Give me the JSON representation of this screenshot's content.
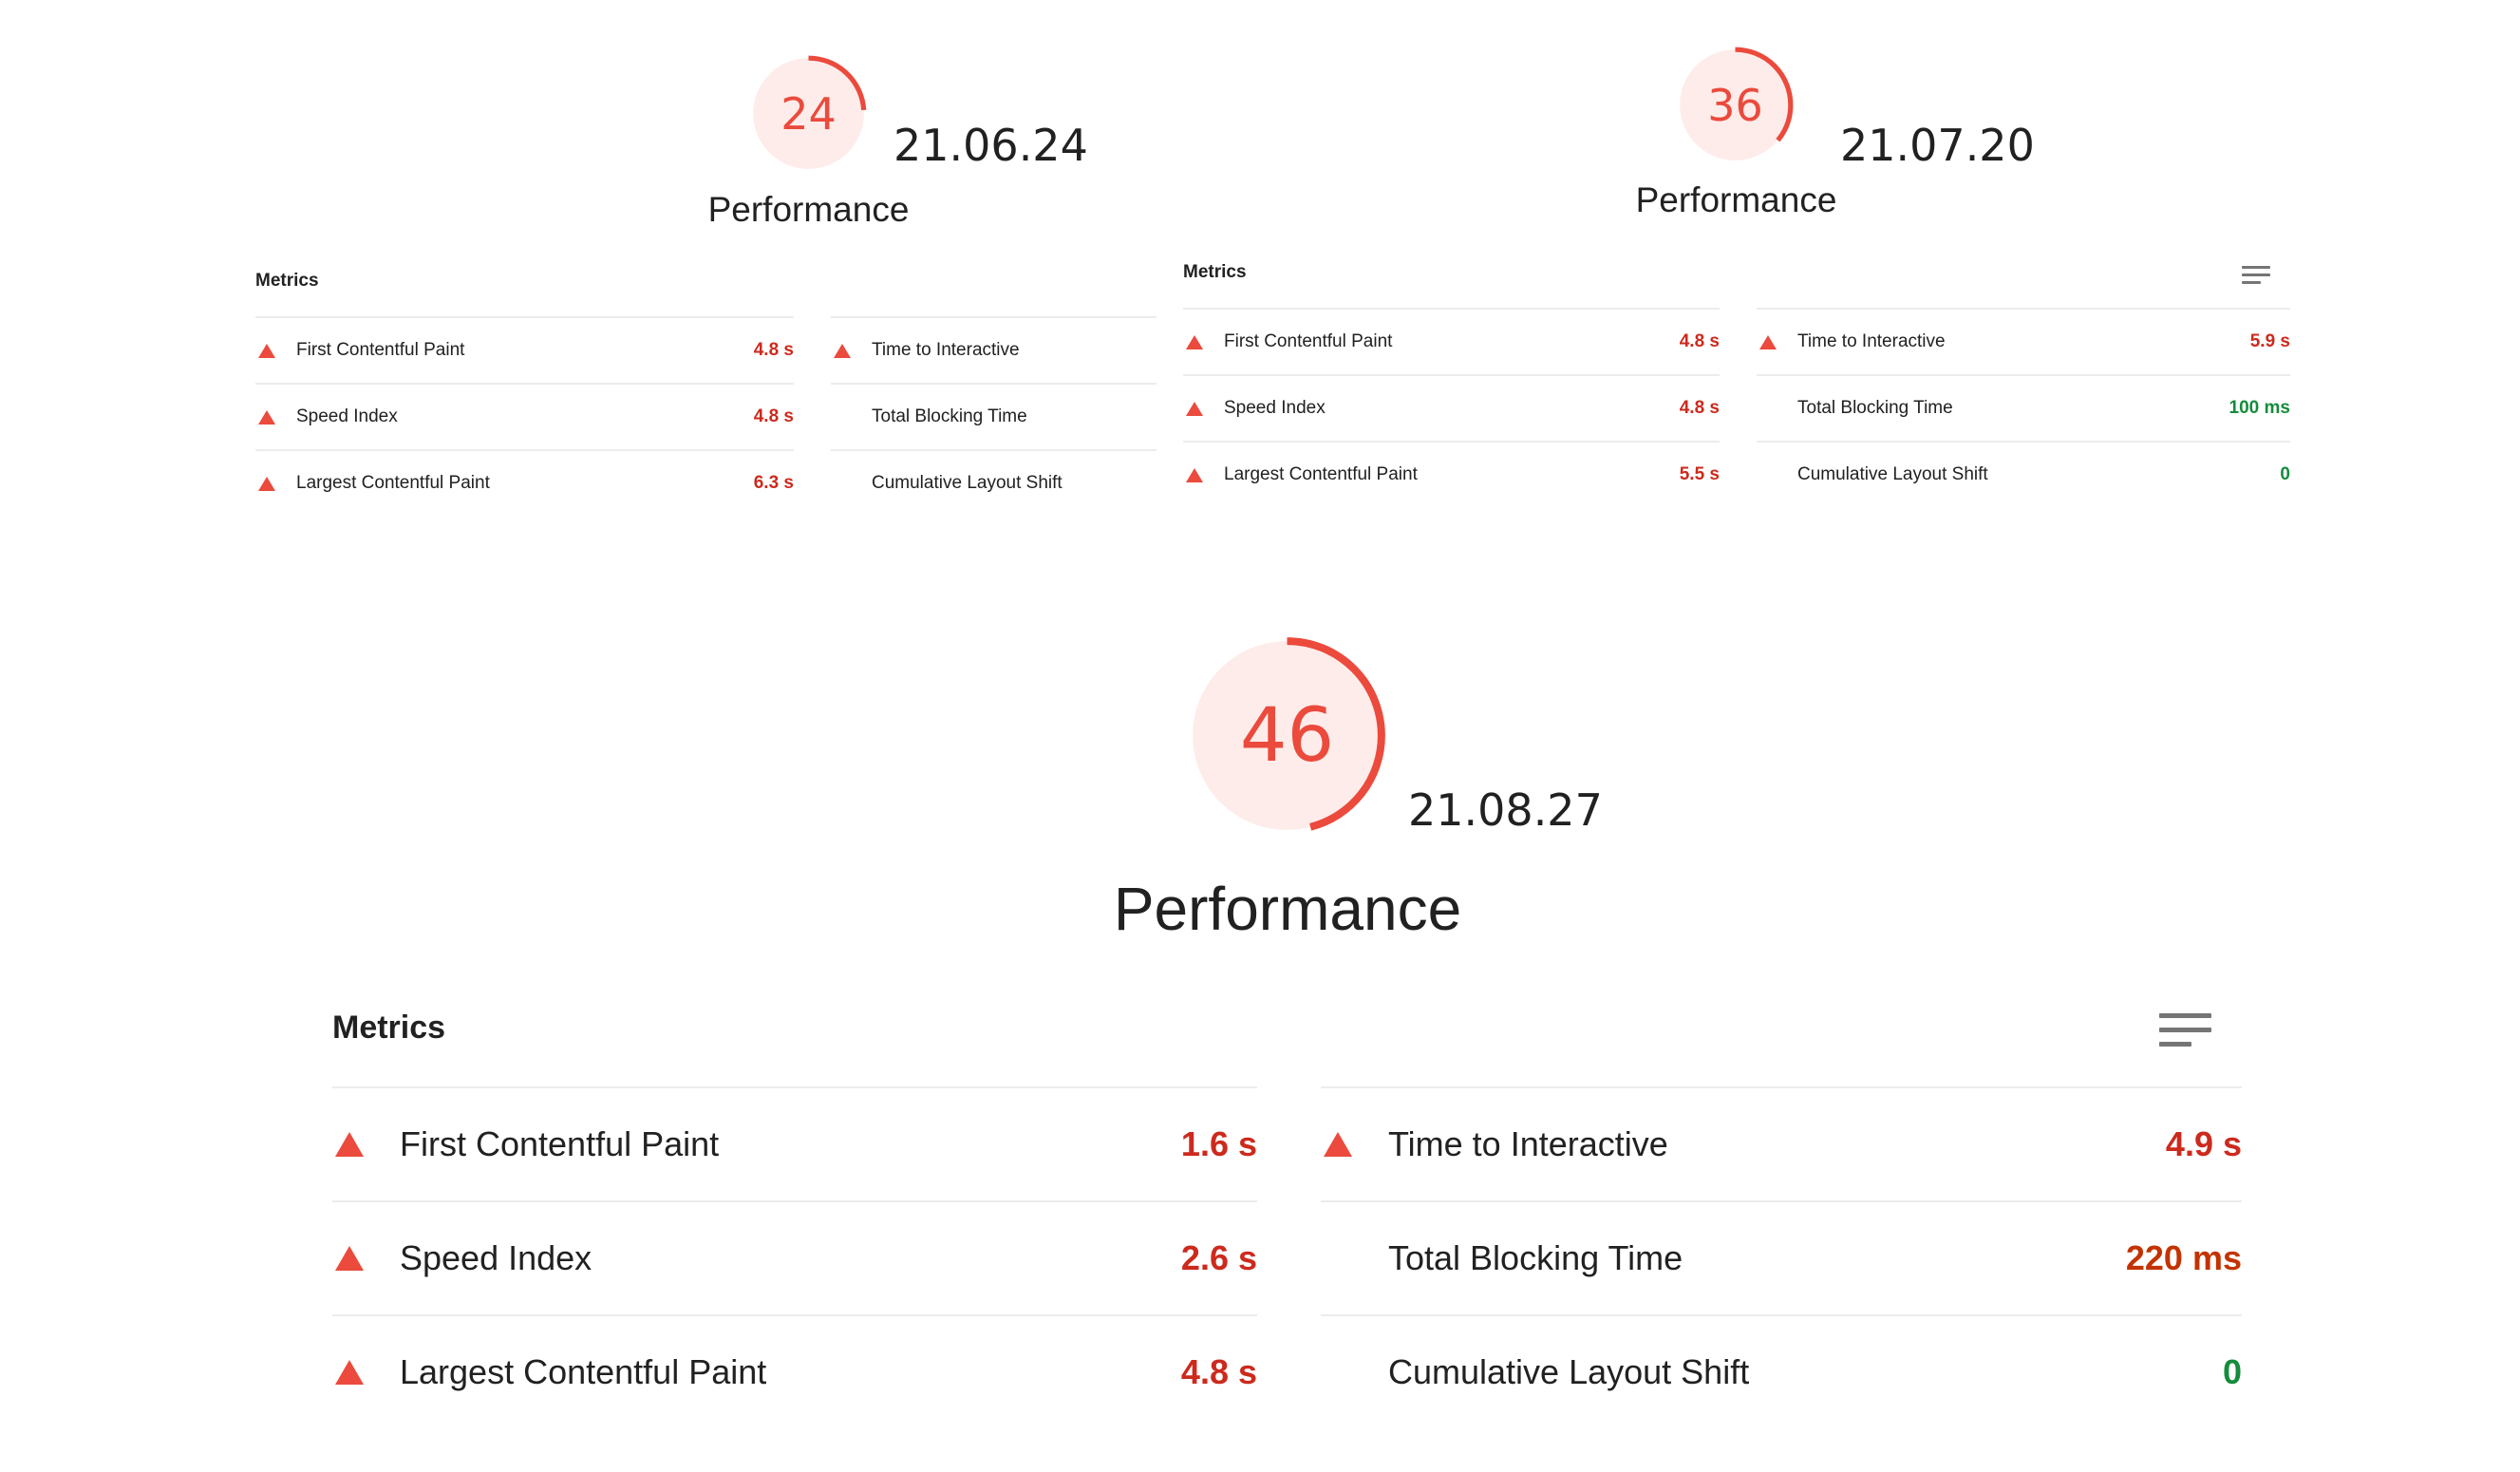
{
  "reports": [
    {
      "score": 24,
      "date": "21.06.24",
      "category": "Performance",
      "metrics_title": "Metrics",
      "left": [
        {
          "label": "First Contentful Paint",
          "value": "4.8 s",
          "status": "fail"
        },
        {
          "label": "Speed Index",
          "value": "4.8 s",
          "status": "fail"
        },
        {
          "label": "Largest Contentful Paint",
          "value": "6.3 s",
          "status": "fail"
        }
      ],
      "right": [
        {
          "label": "Time to Interactive",
          "value": "",
          "status": "fail"
        },
        {
          "label": "Total Blocking Time",
          "value": "",
          "status": "none"
        },
        {
          "label": "Cumulative Layout Shift",
          "value": "",
          "status": "none"
        }
      ]
    },
    {
      "score": 36,
      "date": "21.07.20",
      "category": "Performance",
      "metrics_title": "Metrics",
      "left": [
        {
          "label": "First Contentful Paint",
          "value": "4.8 s",
          "status": "fail"
        },
        {
          "label": "Speed Index",
          "value": "4.8 s",
          "status": "fail"
        },
        {
          "label": "Largest Contentful Paint",
          "value": "5.5 s",
          "status": "fail"
        }
      ],
      "right": [
        {
          "label": "Time to Interactive",
          "value": "5.9 s",
          "status": "fail"
        },
        {
          "label": "Total Blocking Time",
          "value": "100 ms",
          "status": "pass"
        },
        {
          "label": "Cumulative Layout Shift",
          "value": "0",
          "status": "pass"
        }
      ]
    },
    {
      "score": 46,
      "date": "21.08.27",
      "category": "Performance",
      "metrics_title": "Metrics",
      "left": [
        {
          "label": "First Contentful Paint",
          "value": "1.6 s",
          "status": "fail"
        },
        {
          "label": "Speed Index",
          "value": "2.6 s",
          "status": "fail"
        },
        {
          "label": "Largest Contentful Paint",
          "value": "4.8 s",
          "status": "fail"
        }
      ],
      "right": [
        {
          "label": "Time to Interactive",
          "value": "4.9 s",
          "status": "fail"
        },
        {
          "label": "Total Blocking Time",
          "value": "220 ms",
          "status": "average"
        },
        {
          "label": "Cumulative Layout Shift",
          "value": "0",
          "status": "pass"
        }
      ]
    }
  ],
  "colors": {
    "fail": "#eb4a3c",
    "fail_text": "#cc2a1d",
    "average_text": "#c33300",
    "pass_text": "#158c3c",
    "gauge_bg": "#fdecea",
    "divider": "#ececec"
  },
  "icons": [
    "warning-triangle-icon",
    "menu-icon"
  ]
}
